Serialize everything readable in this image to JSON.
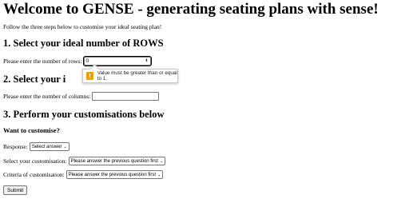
{
  "page": {
    "title": "Welcome to GENSE - generating seating plans with sense!",
    "intro": "Follow the three steps below to customise your ideal seating plan!"
  },
  "step1": {
    "heading": "1. Select your ideal number of ROWS",
    "label": "Please enter the number of rows:",
    "value": "0"
  },
  "step2": {
    "heading_visible": "2. Select your i",
    "label": "Please enter the number of columns:",
    "value": ""
  },
  "step3": {
    "heading": "3. Perform your customisations below",
    "subheading": "Want to customise?",
    "response_label": "Response:",
    "response_value": "Select answer",
    "customisation_label": "Select your customisation:",
    "customisation_value": "Please answer the previous question first",
    "criteria_label": "Criteria of customisation:",
    "criteria_value": "Please answer the previous question first"
  },
  "submit_label": "Submit",
  "validation": {
    "icon": "warning-icon",
    "message": "Value must be greater than or equal to 1.",
    "icon_color": "#f0a000"
  }
}
